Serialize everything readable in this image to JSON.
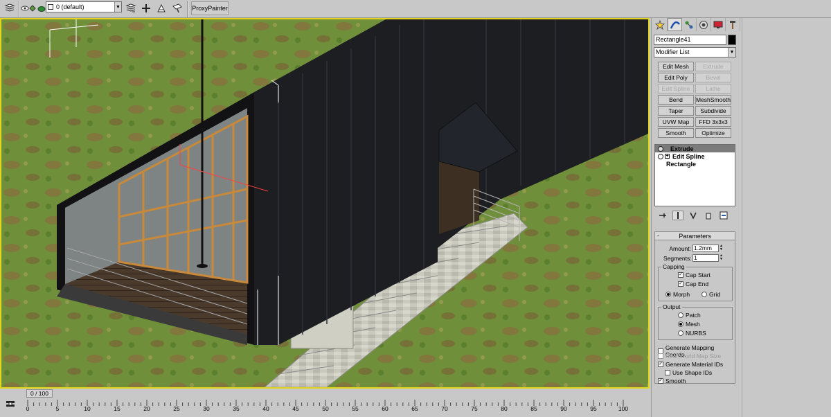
{
  "toolbar": {
    "layer_dropdown": "0 (default)",
    "proxypainter_label": "ProxyPainter"
  },
  "command_panel": {
    "object_name": "Rectangle41",
    "object_color": "#000000",
    "modifier_list_label": "Modifier List",
    "modifier_buttons": [
      {
        "label": "Edit Mesh",
        "enabled": true
      },
      {
        "label": "Extrude",
        "enabled": false
      },
      {
        "label": "Edit Poly",
        "enabled": true
      },
      {
        "label": "Bevel",
        "enabled": false
      },
      {
        "label": "Edit Spline",
        "enabled": false
      },
      {
        "label": "Lathe",
        "enabled": false
      },
      {
        "label": "Bend",
        "enabled": true
      },
      {
        "label": "MeshSmooth",
        "enabled": true
      },
      {
        "label": "Taper",
        "enabled": true
      },
      {
        "label": "Subdivide",
        "enabled": true
      },
      {
        "label": "UVW Map",
        "enabled": true
      },
      {
        "label": "FFD 3x3x3",
        "enabled": true
      },
      {
        "label": "Smooth",
        "enabled": true
      },
      {
        "label": "Optimize",
        "enabled": true
      }
    ],
    "stack": [
      {
        "label": "Extrude",
        "selected": true
      },
      {
        "label": "Edit Spline",
        "selected": false
      },
      {
        "label": "Rectangle",
        "selected": false
      }
    ],
    "parameters": {
      "title": "Parameters",
      "collapse_symbol": "-",
      "amount_label": "Amount:",
      "amount_value": "1.2mm",
      "segments_label": "Segments:",
      "segments_value": "1",
      "capping_title": "Capping",
      "cap_start_label": "Cap Start",
      "cap_start_checked": true,
      "cap_end_label": "Cap End",
      "cap_end_checked": true,
      "morph_label": "Morph",
      "grid_label": "Grid",
      "capping_selected": "Morph",
      "output_title": "Output",
      "patch_label": "Patch",
      "mesh_label": "Mesh",
      "nurbs_label": "NURBS",
      "output_selected": "Mesh",
      "gen_mapping_label": "Generate Mapping Coords.",
      "gen_mapping_checked": false,
      "real_world_label": "Real-World Map Size",
      "real_world_checked": false,
      "gen_material_label": "Generate Material IDs",
      "gen_material_checked": true,
      "use_shape_label": "Use Shape IDs",
      "use_shape_checked": false,
      "smooth_label": "Smooth",
      "smooth_checked": true
    }
  },
  "timeline": {
    "frame_display": "0 / 100",
    "ticks": [
      "0",
      "5",
      "10",
      "15",
      "20",
      "25",
      "30",
      "35",
      "40",
      "45",
      "50",
      "55",
      "60",
      "65",
      "70",
      "75",
      "80",
      "85",
      "90",
      "95",
      "100"
    ]
  },
  "viewport": {
    "border_color": "#e2d51e"
  }
}
